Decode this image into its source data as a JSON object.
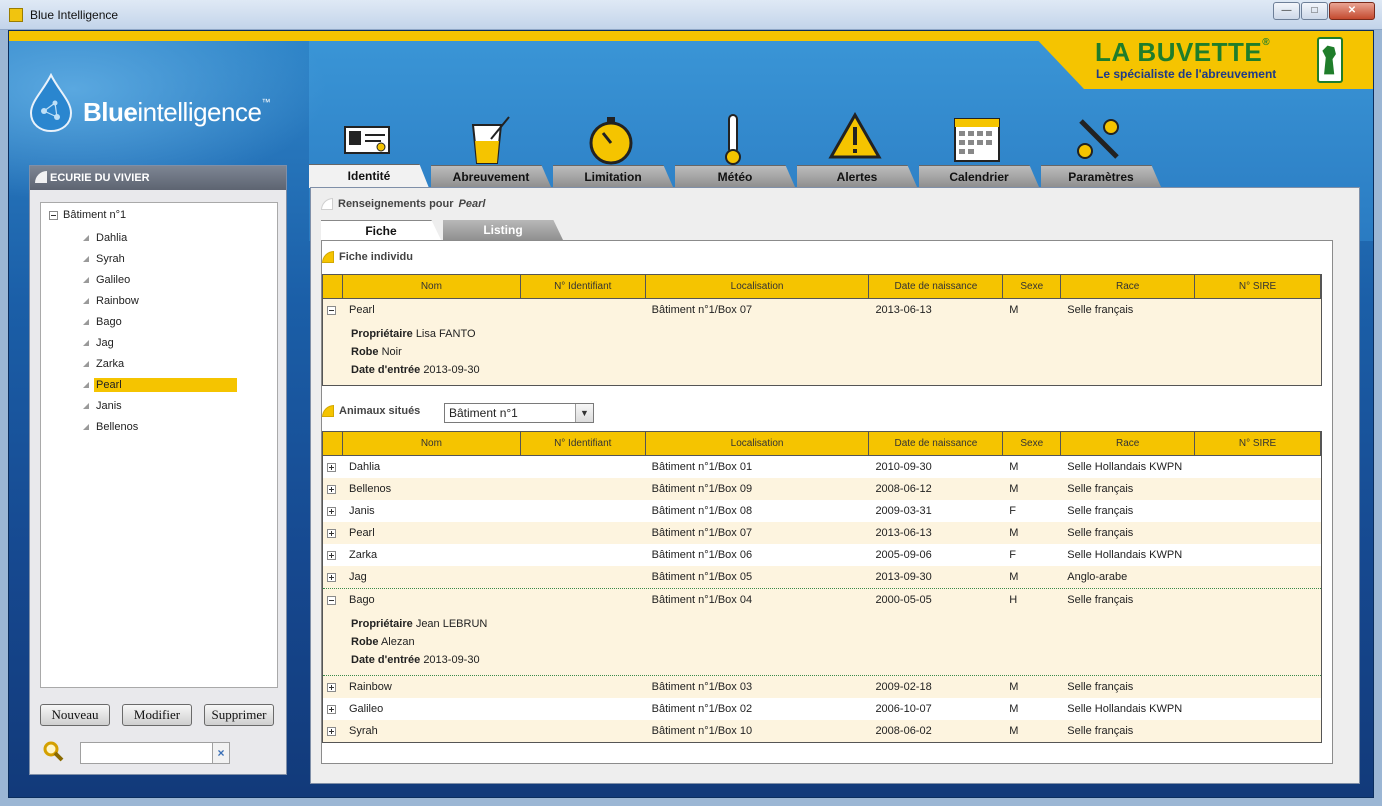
{
  "window": {
    "title": "Blue Intelligence"
  },
  "logos": {
    "blue_intelligence": {
      "bold": "Blue",
      "rest": "intelligence",
      "tm": "™"
    },
    "la_buvette": {
      "name": "LA BUVETTE",
      "reg": "®",
      "tagline": "Le spécialiste de l'abreuvement"
    }
  },
  "sidebar": {
    "title": "ECURIE DU VIVIER",
    "root": "Bâtiment n°1",
    "items": [
      "Dahlia",
      "Syrah",
      "Galileo",
      "Rainbow",
      "Bago",
      "Jag",
      "Zarka",
      "Pearl",
      "Janis",
      "Bellenos"
    ],
    "selected": "Pearl",
    "buttons": {
      "new": "Nouveau",
      "edit": "Modifier",
      "delete": "Supprimer"
    },
    "search_clear": "×",
    "search_value": ""
  },
  "tabs": [
    "Identité",
    "Abreuvement",
    "Limitation",
    "Météo",
    "Alertes",
    "Calendrier",
    "Paramètres"
  ],
  "tab_icons": [
    "id-card-icon",
    "drink-glass-icon",
    "stopwatch-icon",
    "thermometer-icon",
    "warning-icon",
    "calendar-icon",
    "tools-icon"
  ],
  "main": {
    "info_label": "Renseignements pour",
    "info_name": "Pearl",
    "subtabs": [
      "Fiche",
      "Listing"
    ],
    "fiche_title": "Fiche individu",
    "animaux_title": "Animaux situés",
    "location_select": "Bâtiment n°1",
    "columns": [
      "Nom",
      "N° Identifiant",
      "Localisation",
      "Date de naissance",
      "Sexe",
      "Race",
      "N° SIRE"
    ],
    "detail_labels": {
      "owner": "Propriétaire",
      "robe": "Robe",
      "entry": "Date d'entrée"
    },
    "fiche_row": {
      "nom": "Pearl",
      "id": "",
      "loc": "Bâtiment n°1/Box 07",
      "birth": "2013-06-13",
      "sexe": "M",
      "race": "Selle français",
      "sire": "",
      "owner": "Lisa FANTO",
      "robe": "Noir",
      "entry": "2013-09-30"
    },
    "animals": [
      {
        "nom": "Dahlia",
        "loc": "Bâtiment n°1/Box 01",
        "birth": "2010-09-30",
        "sexe": "M",
        "race": "Selle Hollandais KWPN"
      },
      {
        "nom": "Bellenos",
        "loc": "Bâtiment n°1/Box 09",
        "birth": "2008-06-12",
        "sexe": "M",
        "race": "Selle français"
      },
      {
        "nom": "Janis",
        "loc": "Bâtiment n°1/Box 08",
        "birth": "2009-03-31",
        "sexe": "F",
        "race": "Selle français"
      },
      {
        "nom": "Pearl",
        "loc": "Bâtiment n°1/Box 07",
        "birth": "2013-06-13",
        "sexe": "M",
        "race": "Selle français"
      },
      {
        "nom": "Zarka",
        "loc": "Bâtiment n°1/Box 06",
        "birth": "2005-09-06",
        "sexe": "F",
        "race": "Selle Hollandais KWPN"
      },
      {
        "nom": "Jag",
        "loc": "Bâtiment n°1/Box 05",
        "birth": "2013-09-30",
        "sexe": "M",
        "race": "Anglo-arabe"
      },
      {
        "nom": "Bago",
        "loc": "Bâtiment n°1/Box 04",
        "birth": "2000-05-05",
        "sexe": "H",
        "race": "Selle français",
        "owner": "Jean LEBRUN",
        "robe": "Alezan",
        "entry": "2013-09-30"
      },
      {
        "nom": "Rainbow",
        "loc": "Bâtiment n°1/Box 03",
        "birth": "2009-02-18",
        "sexe": "M",
        "race": "Selle français"
      },
      {
        "nom": "Galileo",
        "loc": "Bâtiment n°1/Box 02",
        "birth": "2006-10-07",
        "sexe": "M",
        "race": "Selle Hollandais KWPN"
      },
      {
        "nom": "Syrah",
        "loc": "Bâtiment n°1/Box 10",
        "birth": "2008-06-02",
        "sexe": "M",
        "race": "Selle français"
      }
    ]
  },
  "colors": {
    "accent_yellow": "#f5c400",
    "brand_blue": "#1b5fa8",
    "la_buvette_green": "#1f7d2a"
  }
}
